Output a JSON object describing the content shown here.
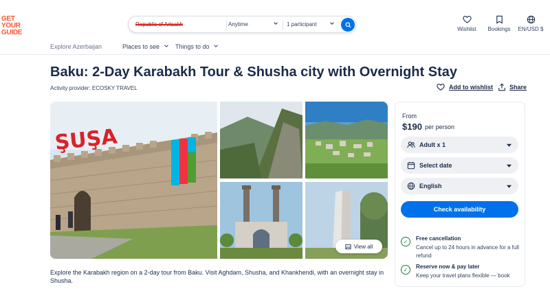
{
  "logo": {
    "line1": "GET",
    "line2": "YOUR",
    "line3": "GUIDE"
  },
  "search": {
    "destination": "Republic of Artsakh",
    "date": "Anytime",
    "participants": "1 participant"
  },
  "header_actions": {
    "wishlist": "Wishlist",
    "bookings": "Bookings",
    "locale": "EN/USD $"
  },
  "nav": {
    "explore": "Explore Azerbaijan",
    "places": "Places to see",
    "things": "Things to do"
  },
  "activity": {
    "title": "Baku: 2-Day Karabakh Tour & Shusha city with Overnight Stay",
    "provider": "Activity provider: ECOSKY TRAVEL",
    "add_to_wishlist": "Add to wishlist",
    "share": "Share",
    "description": "Explore the Karabakh region on a 2-day tour from Baku. Visit Aghdam, Shusha, and Khankhendi, with an overnight stay in Shusha."
  },
  "gallery": {
    "main_sign": "ŞUŞA",
    "view_all": "View all"
  },
  "booking": {
    "from_label": "From",
    "price": "$190",
    "price_unit": "per person",
    "adults": "Adult x 1",
    "date": "Select date",
    "language": "English",
    "check_button": "Check availability",
    "perks": [
      {
        "title": "Free cancellation",
        "desc": "Cancel up to 24 hours in advance for a full refund"
      },
      {
        "title": "Reserve now & pay later",
        "desc": "Keep your travel plans flexible — book"
      }
    ]
  },
  "colors": {
    "brand_orange": "#ff5533",
    "accent_blue": "#0071eb",
    "text_dark": "#1a2b49",
    "perk_green": "#1a7a3c"
  }
}
